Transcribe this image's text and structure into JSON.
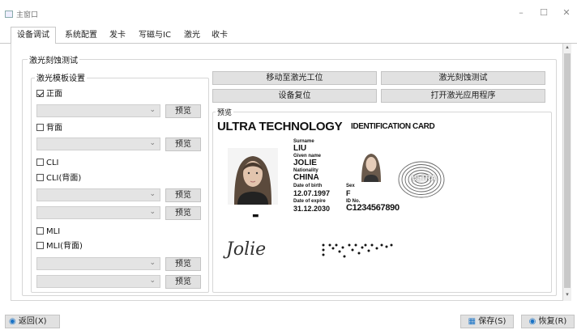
{
  "window": {
    "title": "主窗口",
    "minimize_icon": "minimize-icon",
    "maximize_icon": "maximize-icon",
    "close_icon": "close-icon"
  },
  "tabs": [
    "设备调试",
    "系统配置",
    "发卡",
    "写磁与IC",
    "激光",
    "收卡"
  ],
  "active_tab": 0,
  "laser_section": {
    "title": "激光刻蚀测试",
    "template_group": {
      "title": "激光模板设置",
      "options": [
        {
          "label": "正面",
          "checked": true
        },
        {
          "label": "背面",
          "checked": false
        },
        {
          "label": "CLI",
          "checked": false
        },
        {
          "label": "CLI(背面)",
          "checked": false
        },
        {
          "label": "MLI",
          "checked": false
        },
        {
          "label": "MLI(背面)",
          "checked": false
        }
      ],
      "preview_label": "预览"
    },
    "buttons": {
      "move_to_laser": "移动至激光工位",
      "laser_test": "激光刻蚀测试",
      "device_reset": "设备复位",
      "open_laser_app": "打开激光应用程序"
    },
    "preview_title": "预览"
  },
  "id_card": {
    "brand": "ULTRA TECHNOLOGY",
    "card_title": "IDENTIFICATION CARD",
    "surname_label": "Surname",
    "surname": "LIU",
    "given_name_label": "Given name",
    "given_name": "JOLIE",
    "nationality_label": "Nationality",
    "nationality": "CHINA",
    "dob_label": "Date of birth",
    "dob": "12.07.1997",
    "sex_label": "Sex",
    "sex": "F",
    "expire_label": "Date of expire",
    "expire": "31.12.2030",
    "id_label": "ID No.",
    "id_no": "C1234567890",
    "signature": "Jolie",
    "fingerprint_text": "ULTRA"
  },
  "footer": {
    "back": "返回(X)",
    "save": "保存(S)",
    "restore": "恢复(R)"
  },
  "colors": {
    "accent": "#1a73c6",
    "tab_bg": "#ffffff",
    "button_bg": "#e1e1e1"
  }
}
